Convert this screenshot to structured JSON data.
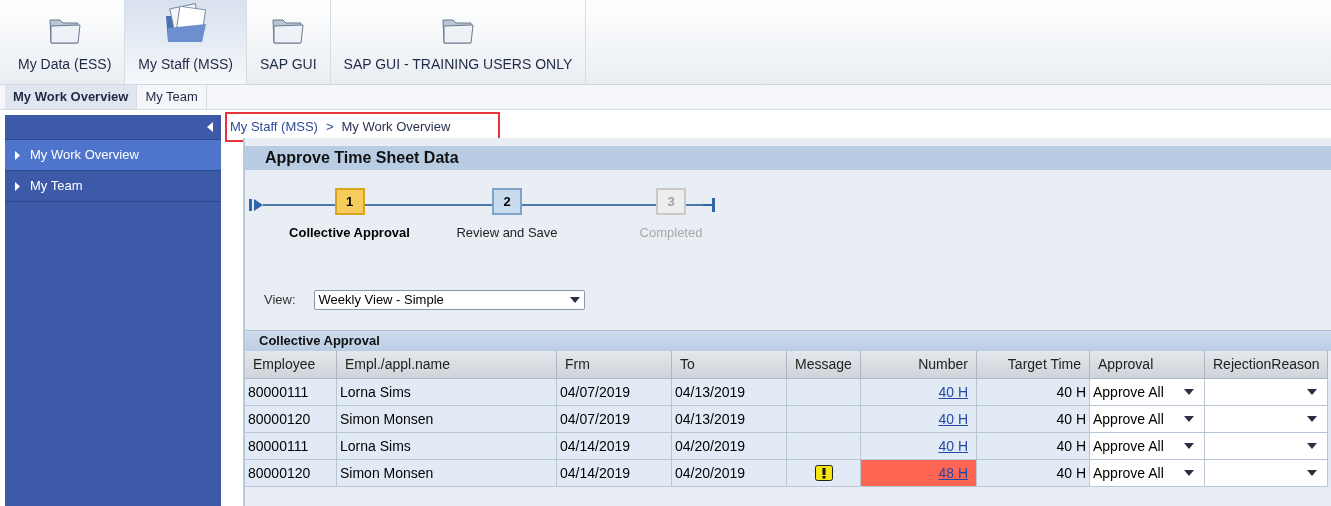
{
  "top_tabs": [
    {
      "label": "My Data (ESS)",
      "selected": false
    },
    {
      "label": "My Staff (MSS)",
      "selected": true
    },
    {
      "label": "SAP GUI",
      "selected": false
    },
    {
      "label": "SAP GUI - TRAINING USERS ONLY",
      "selected": false
    }
  ],
  "sub_tabs": [
    {
      "label": "My Work Overview",
      "selected": true
    },
    {
      "label": "My Team",
      "selected": false
    }
  ],
  "sidebar": {
    "items": [
      {
        "label": "My Work Overview",
        "selected": true
      },
      {
        "label": "My Team",
        "selected": false
      }
    ]
  },
  "breadcrumb": {
    "items": [
      "My Staff (MSS)",
      "My Work Overview"
    ],
    "separator": ">",
    "highlighted": true
  },
  "page_title": "Approve Time Sheet Data",
  "steps": [
    {
      "number": "1",
      "label": "Collective Approval",
      "kind": "current"
    },
    {
      "number": "2",
      "label": "Review and Save",
      "kind": "next"
    },
    {
      "number": "3",
      "label": "Completed",
      "kind": "disabled"
    }
  ],
  "view": {
    "label": "View:",
    "value": "Weekly View - Simple"
  },
  "table": {
    "title": "Collective Approval",
    "columns": [
      "Employee",
      "Empl./appl.name",
      "Frm",
      "To",
      "Message",
      "Number",
      "Target Time",
      "Approval",
      "RejectionReason"
    ],
    "rows": [
      {
        "employee": "80000111",
        "name": "Lorna Sims",
        "from": "04/07/2019",
        "to": "04/13/2019",
        "warning": false,
        "number": "40 H",
        "over_target": false,
        "target": "40 H",
        "approval": "Approve All"
      },
      {
        "employee": "80000120",
        "name": "Simon Monsen",
        "from": "04/07/2019",
        "to": "04/13/2019",
        "warning": false,
        "number": "40 H",
        "over_target": false,
        "target": "40 H",
        "approval": "Approve All"
      },
      {
        "employee": "80000111",
        "name": "Lorna Sims",
        "from": "04/14/2019",
        "to": "04/20/2019",
        "warning": false,
        "number": "40 H",
        "over_target": false,
        "target": "40 H",
        "approval": "Approve All"
      },
      {
        "employee": "80000120",
        "name": "Simon Monsen",
        "from": "04/14/2019",
        "to": "04/20/2019",
        "warning": true,
        "number": "48 H",
        "over_target": true,
        "target": "40 H",
        "approval": "Approve All"
      }
    ]
  }
}
